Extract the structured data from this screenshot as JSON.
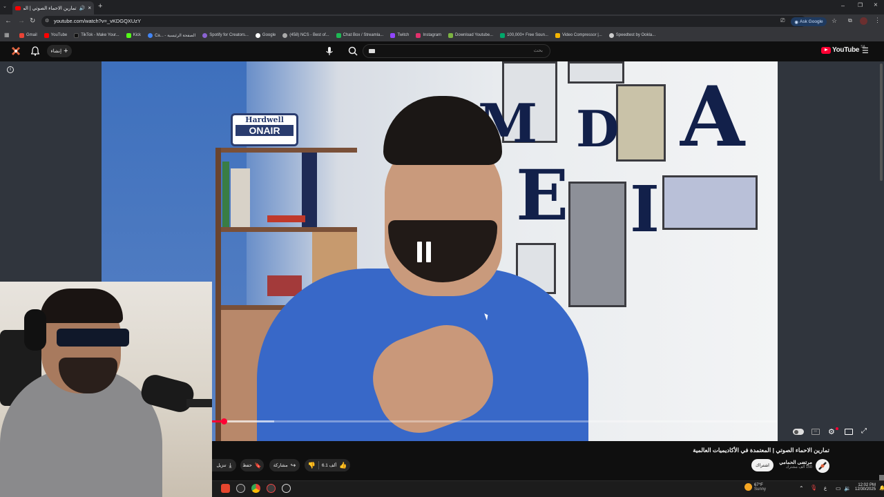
{
  "browser": {
    "tab_title": "تمارين الاحماء الصوتي | المعـ",
    "url": "youtube.com/watch?v=_vKDGQXUzY",
    "ask_google": "Ask Google",
    "bookmarks": [
      {
        "label": "Gmail",
        "color": "#ea4335"
      },
      {
        "label": "YouTube",
        "color": "#ff0000"
      },
      {
        "label": "TikTok - Make Your...",
        "color": "#111111"
      },
      {
        "label": "Kick",
        "color": "#53fc18"
      },
      {
        "label": "Ca... - الصفحة الرئيسية",
        "color": "#4285f4"
      },
      {
        "label": "Spotify for Creators...",
        "color": "#8a63d2"
      },
      {
        "label": "Google",
        "color": "#4285f4"
      },
      {
        "label": "(458) NCS - Best of...",
        "color": "#aaaaaa"
      },
      {
        "label": "Chat Box / Streamla...",
        "color": "#1db954"
      },
      {
        "label": "Twitch",
        "color": "#9146ff"
      },
      {
        "label": "Instagram",
        "color": "#e1306c"
      },
      {
        "label": "Download Youtube...",
        "color": "#7cb342"
      },
      {
        "label": "100,000+ Free Soun...",
        "color": "#00a86b"
      },
      {
        "label": "Video Compressor |...",
        "color": "#f4b400"
      },
      {
        "label": "Speedtest by Ookla...",
        "color": "#cccccc"
      }
    ]
  },
  "masthead": {
    "create_label": "إنشاء",
    "search_placeholder": "بحث",
    "logo_text": "YouTube",
    "region": "SA"
  },
  "video": {
    "sign_top": "Hardwell",
    "sign_bottom": "ONAIR",
    "wall_letters": [
      "M",
      "D",
      "A",
      "E",
      "I"
    ],
    "progress_fraction": 0.02,
    "buffer_fraction": 0.11
  },
  "info": {
    "title": "تمارين الاحماء الصوتي | المعتمدة في الأكاديميات العالمية",
    "channel_name": "مرتضى الحمامي",
    "subscribers": "150 ألف مشترك",
    "subscribe_label": "اشتراك",
    "like_count": "6.1 ألف",
    "share_label": "مشاركة",
    "save_label": "حفظ",
    "download_label": "تنزيل"
  },
  "taskbar": {
    "weather_temp": "67°F",
    "weather_desc": "Sunny",
    "lang": "ع",
    "time": "12:02 PM",
    "date": "12/30/2025"
  },
  "colors": {
    "brand_red": "#ff0033",
    "bg": "#0f0f0f"
  }
}
